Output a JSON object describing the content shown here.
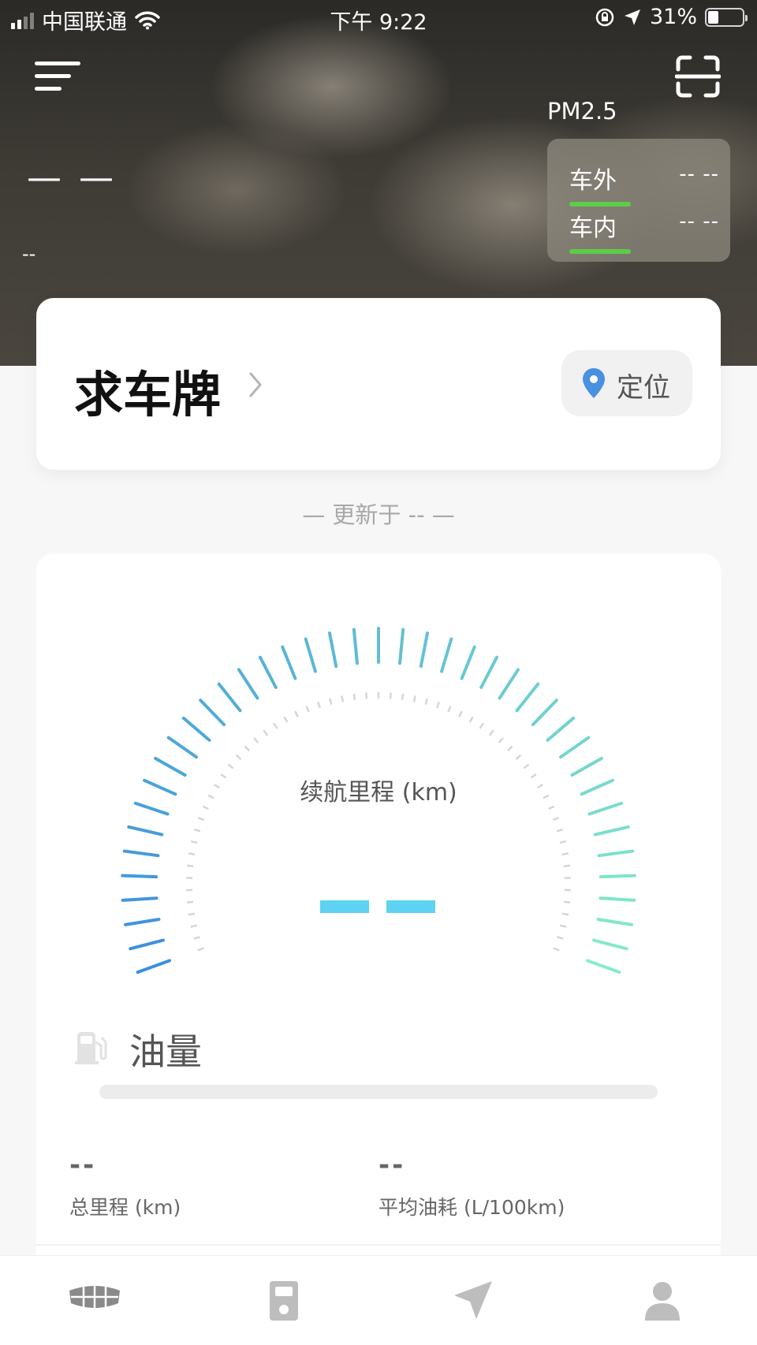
{
  "status_bar": {
    "carrier": "中国联通",
    "time": "下午 9:22",
    "battery_percent": "31%",
    "battery_level": 0.31
  },
  "weather": {
    "temperature": "— —",
    "condition": "--"
  },
  "pm25": {
    "label": "PM2.5",
    "outside_label": "车外",
    "outside_value": "--  --",
    "inside_label": "车内",
    "inside_value": "--  --",
    "level_color": "#5ccd48"
  },
  "vehicle": {
    "plate_title": "求车牌",
    "locate_label": "定位",
    "update_text": "— 更新于 -- —"
  },
  "gauge": {
    "label": "续航里程 (km)",
    "value": "——",
    "color_start": "#3b8fe0",
    "color_end": "#86ecc8"
  },
  "fuel": {
    "label": "油量",
    "level": 0
  },
  "stats": {
    "total_mileage_value": "--",
    "total_mileage_label": "总里程 (km)",
    "avg_fuel_value": "--",
    "avg_fuel_label": "平均油耗 (L/100km)"
  },
  "tabs": [
    {
      "icon": "car-brand-icon",
      "active": true
    },
    {
      "icon": "fuel-station-icon",
      "active": false
    },
    {
      "icon": "navigation-icon",
      "active": false
    },
    {
      "icon": "profile-icon",
      "active": false
    }
  ]
}
